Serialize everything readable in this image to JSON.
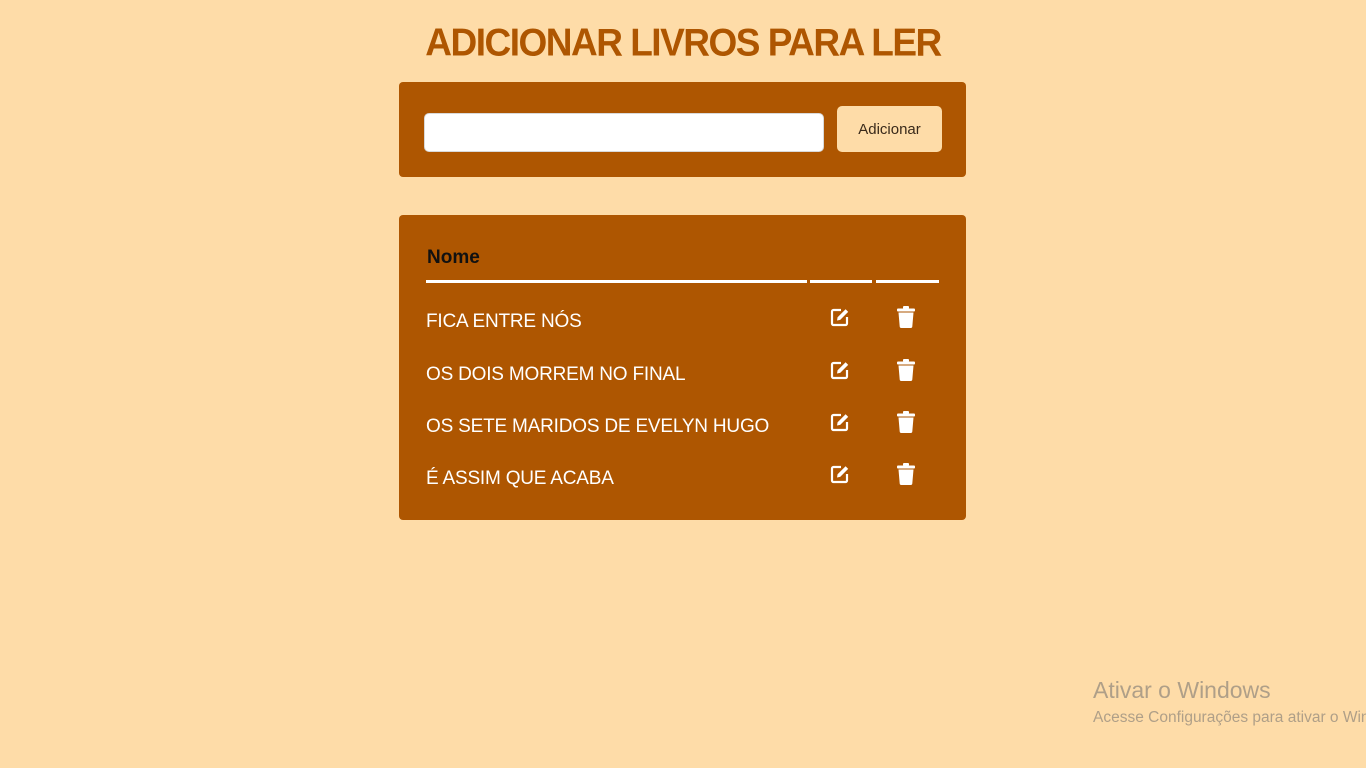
{
  "header": {
    "title": "ADICIONAR LIVROS PARA LER"
  },
  "add_form": {
    "input_value": "",
    "input_placeholder": "",
    "button_label": "Adicionar"
  },
  "table": {
    "column_name": "Nome",
    "rows": [
      {
        "name": "FICA ENTRE NÓS",
        "edit_icon": "edit-icon",
        "delete_icon": "trash-icon"
      },
      {
        "name": "OS DOIS MORREM NO FINAL",
        "edit_icon": "edit-icon",
        "delete_icon": "trash-icon"
      },
      {
        "name": "OS SETE MARIDOS DE EVELYN HUGO",
        "edit_icon": "edit-icon",
        "delete_icon": "trash-icon"
      },
      {
        "name": "É ASSIM QUE ACABA",
        "edit_icon": "edit-icon",
        "delete_icon": "trash-icon"
      }
    ]
  },
  "watermark": {
    "title": "Ativar o Windows",
    "subtitle": "Acesse Configurações para ativar o Windows."
  },
  "colors": {
    "background": "#FEDCA8",
    "accent": "#AE5601",
    "text_light": "#FFFFFF"
  }
}
